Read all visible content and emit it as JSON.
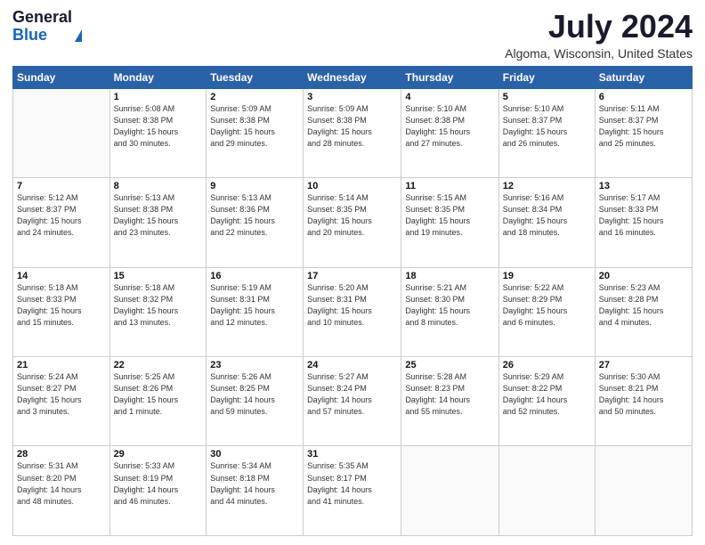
{
  "header": {
    "logo_general": "General",
    "logo_blue": "Blue",
    "title": "July 2024",
    "subtitle": "Algoma, Wisconsin, United States"
  },
  "calendar": {
    "weekdays": [
      "Sunday",
      "Monday",
      "Tuesday",
      "Wednesday",
      "Thursday",
      "Friday",
      "Saturday"
    ],
    "weeks": [
      [
        {
          "day": "",
          "info": ""
        },
        {
          "day": "1",
          "info": "Sunrise: 5:08 AM\nSunset: 8:38 PM\nDaylight: 15 hours\nand 30 minutes."
        },
        {
          "day": "2",
          "info": "Sunrise: 5:09 AM\nSunset: 8:38 PM\nDaylight: 15 hours\nand 29 minutes."
        },
        {
          "day": "3",
          "info": "Sunrise: 5:09 AM\nSunset: 8:38 PM\nDaylight: 15 hours\nand 28 minutes."
        },
        {
          "day": "4",
          "info": "Sunrise: 5:10 AM\nSunset: 8:38 PM\nDaylight: 15 hours\nand 27 minutes."
        },
        {
          "day": "5",
          "info": "Sunrise: 5:10 AM\nSunset: 8:37 PM\nDaylight: 15 hours\nand 26 minutes."
        },
        {
          "day": "6",
          "info": "Sunrise: 5:11 AM\nSunset: 8:37 PM\nDaylight: 15 hours\nand 25 minutes."
        }
      ],
      [
        {
          "day": "7",
          "info": "Sunrise: 5:12 AM\nSunset: 8:37 PM\nDaylight: 15 hours\nand 24 minutes."
        },
        {
          "day": "8",
          "info": "Sunrise: 5:13 AM\nSunset: 8:38 PM\nDaylight: 15 hours\nand 23 minutes."
        },
        {
          "day": "9",
          "info": "Sunrise: 5:13 AM\nSunset: 8:36 PM\nDaylight: 15 hours\nand 22 minutes."
        },
        {
          "day": "10",
          "info": "Sunrise: 5:14 AM\nSunset: 8:35 PM\nDaylight: 15 hours\nand 20 minutes."
        },
        {
          "day": "11",
          "info": "Sunrise: 5:15 AM\nSunset: 8:35 PM\nDaylight: 15 hours\nand 19 minutes."
        },
        {
          "day": "12",
          "info": "Sunrise: 5:16 AM\nSunset: 8:34 PM\nDaylight: 15 hours\nand 18 minutes."
        },
        {
          "day": "13",
          "info": "Sunrise: 5:17 AM\nSunset: 8:33 PM\nDaylight: 15 hours\nand 16 minutes."
        }
      ],
      [
        {
          "day": "14",
          "info": "Sunrise: 5:18 AM\nSunset: 8:33 PM\nDaylight: 15 hours\nand 15 minutes."
        },
        {
          "day": "15",
          "info": "Sunrise: 5:18 AM\nSunset: 8:32 PM\nDaylight: 15 hours\nand 13 minutes."
        },
        {
          "day": "16",
          "info": "Sunrise: 5:19 AM\nSunset: 8:31 PM\nDaylight: 15 hours\nand 12 minutes."
        },
        {
          "day": "17",
          "info": "Sunrise: 5:20 AM\nSunset: 8:31 PM\nDaylight: 15 hours\nand 10 minutes."
        },
        {
          "day": "18",
          "info": "Sunrise: 5:21 AM\nSunset: 8:30 PM\nDaylight: 15 hours\nand 8 minutes."
        },
        {
          "day": "19",
          "info": "Sunrise: 5:22 AM\nSunset: 8:29 PM\nDaylight: 15 hours\nand 6 minutes."
        },
        {
          "day": "20",
          "info": "Sunrise: 5:23 AM\nSunset: 8:28 PM\nDaylight: 15 hours\nand 4 minutes."
        }
      ],
      [
        {
          "day": "21",
          "info": "Sunrise: 5:24 AM\nSunset: 8:27 PM\nDaylight: 15 hours\nand 3 minutes."
        },
        {
          "day": "22",
          "info": "Sunrise: 5:25 AM\nSunset: 8:26 PM\nDaylight: 15 hours\nand 1 minute."
        },
        {
          "day": "23",
          "info": "Sunrise: 5:26 AM\nSunset: 8:25 PM\nDaylight: 14 hours\nand 59 minutes."
        },
        {
          "day": "24",
          "info": "Sunrise: 5:27 AM\nSunset: 8:24 PM\nDaylight: 14 hours\nand 57 minutes."
        },
        {
          "day": "25",
          "info": "Sunrise: 5:28 AM\nSunset: 8:23 PM\nDaylight: 14 hours\nand 55 minutes."
        },
        {
          "day": "26",
          "info": "Sunrise: 5:29 AM\nSunset: 8:22 PM\nDaylight: 14 hours\nand 52 minutes."
        },
        {
          "day": "27",
          "info": "Sunrise: 5:30 AM\nSunset: 8:21 PM\nDaylight: 14 hours\nand 50 minutes."
        }
      ],
      [
        {
          "day": "28",
          "info": "Sunrise: 5:31 AM\nSunset: 8:20 PM\nDaylight: 14 hours\nand 48 minutes."
        },
        {
          "day": "29",
          "info": "Sunrise: 5:33 AM\nSunset: 8:19 PM\nDaylight: 14 hours\nand 46 minutes."
        },
        {
          "day": "30",
          "info": "Sunrise: 5:34 AM\nSunset: 8:18 PM\nDaylight: 14 hours\nand 44 minutes."
        },
        {
          "day": "31",
          "info": "Sunrise: 5:35 AM\nSunset: 8:17 PM\nDaylight: 14 hours\nand 41 minutes."
        },
        {
          "day": "",
          "info": ""
        },
        {
          "day": "",
          "info": ""
        },
        {
          "day": "",
          "info": ""
        }
      ]
    ]
  }
}
